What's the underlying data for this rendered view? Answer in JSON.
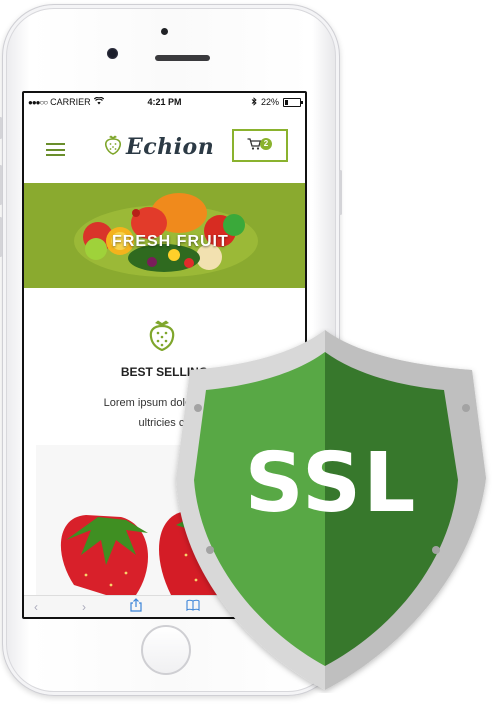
{
  "status_bar": {
    "signal": "●●●○○",
    "carrier": "CARRIER",
    "time": "4:21 PM",
    "battery": "22%"
  },
  "site": {
    "logo_text": "Echion",
    "cart_count": "2",
    "banner_title": "FRESH FRUIT",
    "section_title": "BEST SELLING",
    "section_text_line1": "Lorem ipsum dolor amet,",
    "section_text_line2": "ultricies co"
  },
  "badge": {
    "label": "SSL"
  },
  "colors": {
    "accent_green": "#8ab22e",
    "shield_light": "#58a845",
    "shield_dark": "#37782c",
    "shield_rim": "#d6d6d6"
  }
}
